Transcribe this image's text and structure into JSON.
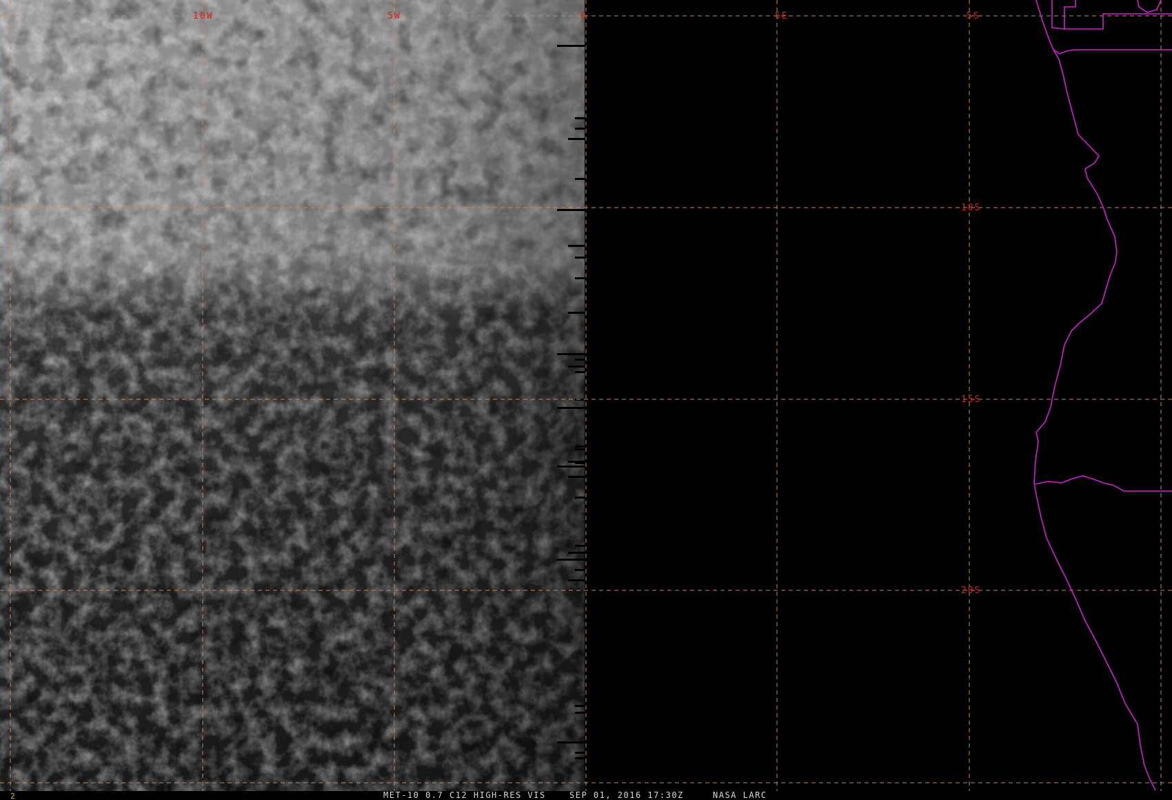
{
  "map": {
    "longitude_labels": [
      "10W",
      "5W",
      "0",
      "5E",
      "5S"
    ],
    "latitude_labels": [
      "10S",
      "15S",
      "20S"
    ],
    "colors": {
      "grid": "#c98a5a",
      "label": "#d0241e",
      "coastline": "#d01ed0",
      "background": "#000000"
    }
  },
  "status_bar": {
    "frame_number": "2",
    "product": "MET-10 0.7 C12 HIGH-RES VIS",
    "timestamp": "SEP 01, 2016 17:30Z",
    "source": "NASA LARC"
  }
}
